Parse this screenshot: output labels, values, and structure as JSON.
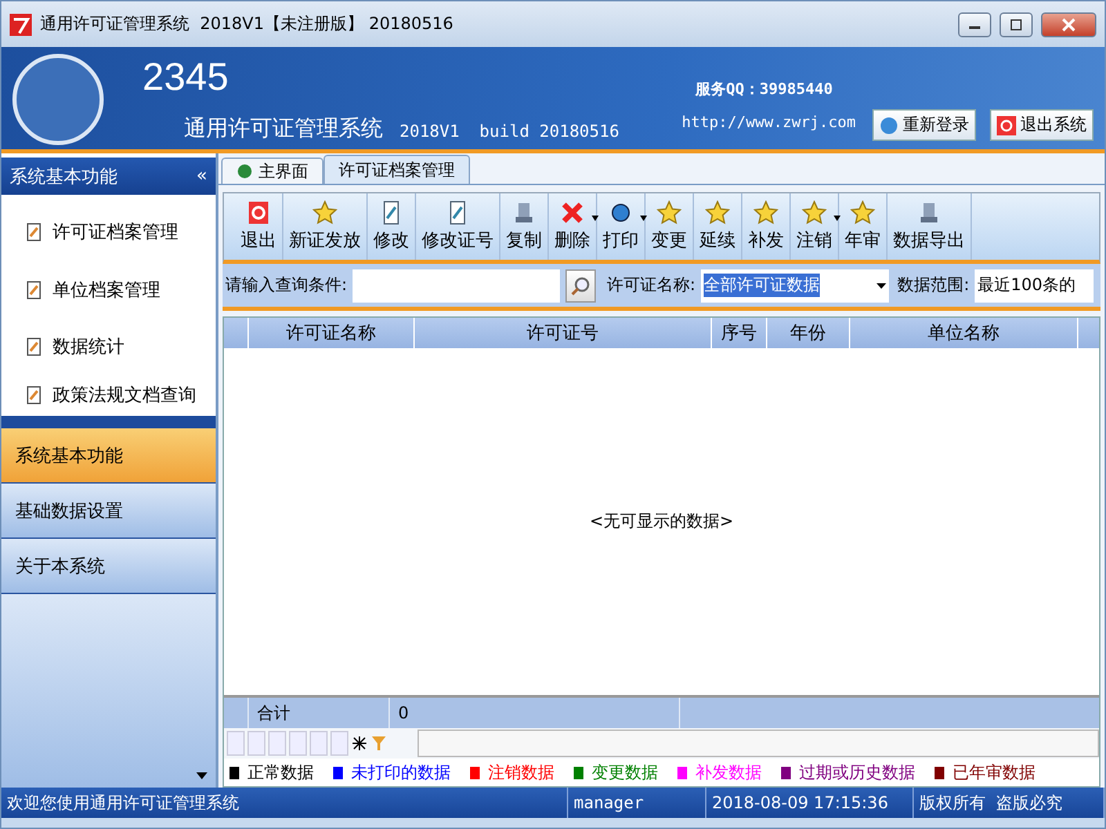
{
  "window": {
    "title": "通用许可证管理系统  2018V1【未注册版】 20180516"
  },
  "header": {
    "logo_number": "2345",
    "product": "通用许可证管理系统",
    "version": "2018V1  build 20180516",
    "qq": "服务QQ：39985440",
    "url": "http://www.zwrj.com",
    "buttons": [
      {
        "label": "重新登录",
        "kind": "relogin"
      },
      {
        "label": "退出系统",
        "kind": "exit"
      }
    ]
  },
  "sidebar": {
    "title": "系统基本功能",
    "collapse": "«",
    "items": [
      {
        "label": "许可证档案管理"
      },
      {
        "label": "单位档案管理"
      },
      {
        "label": "数据统计"
      },
      {
        "label": "政策法规文档查询"
      }
    ],
    "nav": [
      {
        "label": "系统基本功能",
        "selected": true
      },
      {
        "label": "基础数据设置",
        "selected": false
      },
      {
        "label": "关于本系统",
        "selected": false
      }
    ]
  },
  "tabs": [
    {
      "label": "主界面",
      "selected": false
    },
    {
      "label": "许可证档案管理",
      "selected": true
    }
  ],
  "toolbar": [
    {
      "label": "退出",
      "kind": "exit",
      "dropdown": false
    },
    {
      "label": "新证发放",
      "kind": "star",
      "dropdown": false
    },
    {
      "label": "修改",
      "kind": "edit",
      "dropdown": false
    },
    {
      "label": "修改证号",
      "kind": "edit",
      "dropdown": false
    },
    {
      "label": "复制",
      "kind": "copy",
      "dropdown": false
    },
    {
      "label": "删除",
      "kind": "delete",
      "dropdown": true
    },
    {
      "label": "打印",
      "kind": "print",
      "dropdown": true
    },
    {
      "label": "变更",
      "kind": "star",
      "dropdown": false
    },
    {
      "label": "延续",
      "kind": "star",
      "dropdown": false
    },
    {
      "label": "补发",
      "kind": "star",
      "dropdown": false
    },
    {
      "label": "注销",
      "kind": "star",
      "dropdown": true
    },
    {
      "label": "年审",
      "kind": "star",
      "dropdown": false
    },
    {
      "label": "数据导出",
      "kind": "copy",
      "dropdown": false
    }
  ],
  "search": {
    "label": "请输入查询条件:",
    "name_label": "许可证名称:",
    "name_value": "全部许可证数据",
    "range_label": "数据范围:",
    "range_value": "最近100条的"
  },
  "table": {
    "columns": [
      "许可证名称",
      "许可证号",
      "序号",
      "年份",
      "单位名称"
    ],
    "empty_text": "<无可显示的数据>",
    "total_label": "合计",
    "total_value": "0"
  },
  "legend": [
    {
      "label": "正常数据",
      "color": "#000000"
    },
    {
      "label": "未打印的数据",
      "color": "#0000ff"
    },
    {
      "label": "注销数据",
      "color": "#ff0000"
    },
    {
      "label": "变更数据",
      "color": "#008000"
    },
    {
      "label": "补发数据",
      "color": "#ff00ff"
    },
    {
      "label": "过期或历史数据",
      "color": "#800080"
    },
    {
      "label": "已年审数据",
      "color": "#800000"
    }
  ],
  "status_bar": {
    "welcome": "欢迎您使用通用许可证管理系统",
    "user": "manager",
    "time": "2018-08-09 17:15:36",
    "copyright": "版权所有  盗版必究"
  }
}
